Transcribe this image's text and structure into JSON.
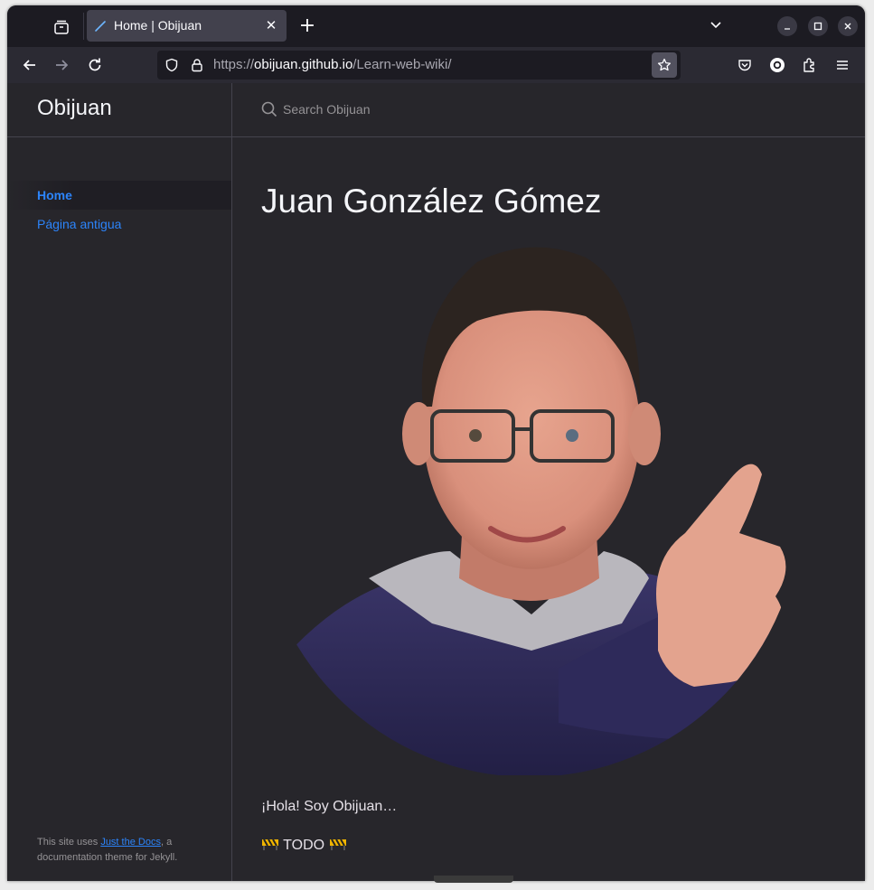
{
  "browser": {
    "tab": {
      "title": "Home | Obijuan"
    },
    "url": {
      "scheme": "https://",
      "host": "obijuan.github.io",
      "path": "/Learn-web-wiki/"
    },
    "icons": [
      "tab-list-icon",
      "close-icon",
      "plus-icon",
      "chevron-down-icon",
      "minimize-icon",
      "maximize-icon",
      "close-window-icon",
      "back-icon",
      "forward-icon",
      "reload-icon",
      "shield-icon",
      "lock-icon",
      "star-icon",
      "pocket-icon",
      "account-icon",
      "extensions-icon",
      "menu-icon"
    ]
  },
  "site": {
    "title": "Obijuan",
    "nav": [
      {
        "label": "Home",
        "active": true
      },
      {
        "label": "Página antigua",
        "active": false
      }
    ],
    "footer": {
      "prefix": "This site uses ",
      "link": "Just the Docs",
      "suffix": ", a documentation theme for Jekyll."
    },
    "search_placeholder": "Search Obijuan"
  },
  "content": {
    "title": "Juan González Gómez",
    "portrait_alt": "Juan González Gómez",
    "greeting": "¡Hola! Soy Obijuan…",
    "todo": "TODO"
  },
  "colors": {
    "accent": "#2c84fa",
    "background": "#27262b",
    "text": "#e6e1e8"
  }
}
